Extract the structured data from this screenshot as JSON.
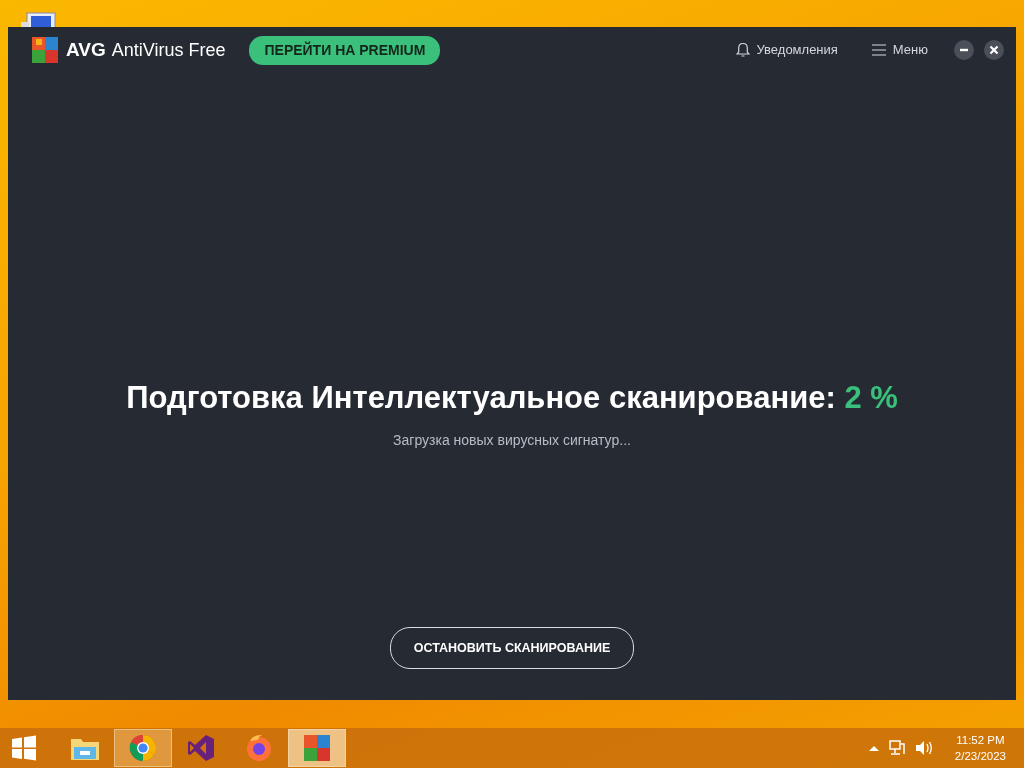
{
  "app": {
    "logo_text": "AVG",
    "title": "AntiVirus Free",
    "upgrade_button": "ПЕРЕЙТИ НА PREMIUM",
    "notifications": "Уведомления",
    "menu": "Меню"
  },
  "scan": {
    "title": "Подготовка Интеллектуальное сканирование:",
    "percent": "2 %",
    "status": "Загрузка новых вирусных сигнатур...",
    "stop_button": "ОСТАНОВИТЬ СКАНИРОВАНИЕ"
  },
  "taskbar": {
    "apps": [
      {
        "kind": "explorer",
        "running": false,
        "focused": false
      },
      {
        "kind": "chrome",
        "running": true,
        "focused": false
      },
      {
        "kind": "studio",
        "running": false,
        "focused": false
      },
      {
        "kind": "firefox",
        "running": false,
        "focused": false
      },
      {
        "kind": "avg",
        "running": true,
        "focused": true
      }
    ],
    "time": "11:52 PM",
    "date": "2/23/2023"
  }
}
